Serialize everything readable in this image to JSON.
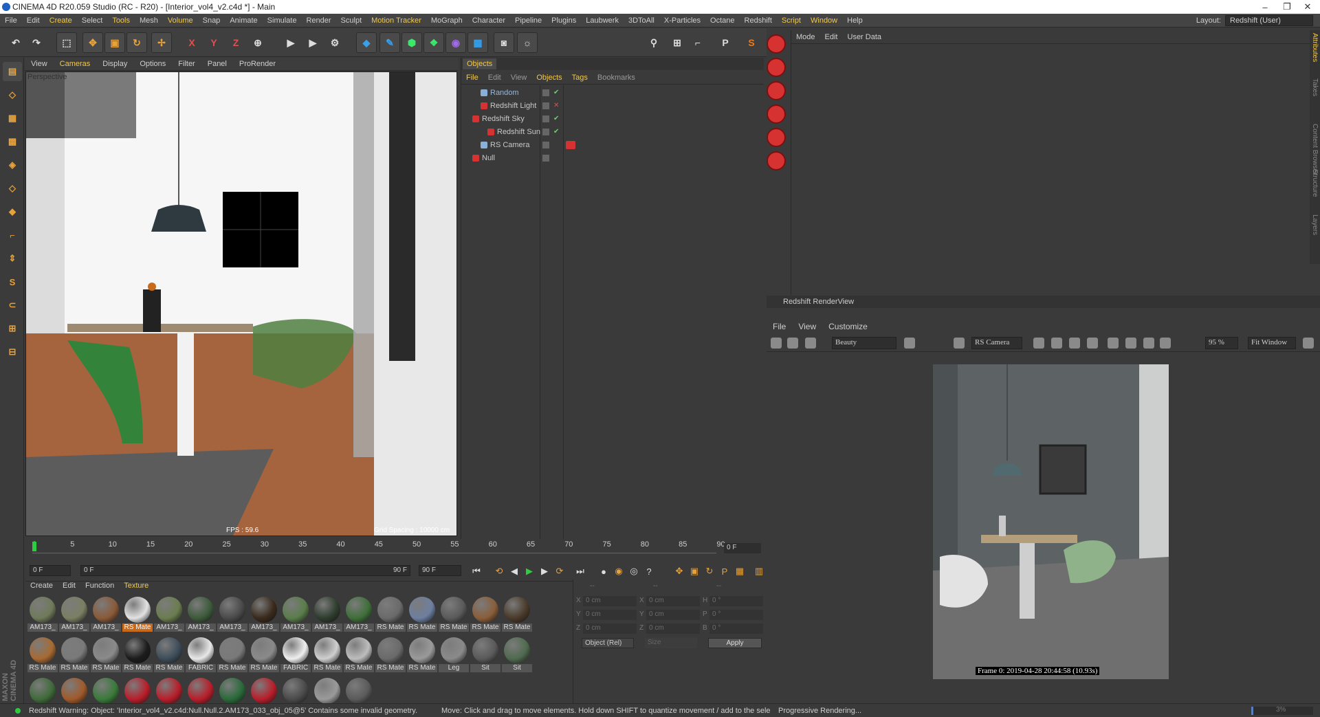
{
  "window": {
    "title": "CINEMA 4D R20.059 Studio (RC - R20) - [Interior_vol4_v2.c4d *] - Main",
    "minimize": "–",
    "restore": "❐",
    "close": "✕"
  },
  "menubar": [
    "File",
    "Edit",
    "Create",
    "Select",
    "Tools",
    "Mesh",
    "Volume",
    "Snap",
    "Animate",
    "Simulate",
    "Render",
    "Sculpt",
    "Motion Tracker",
    "MoGraph",
    "Character",
    "Pipeline",
    "Plugins",
    "Laubwerk",
    "3DToAll",
    "X-Particles",
    "Octane",
    "Redshift",
    "Script",
    "Window",
    "Help"
  ],
  "menubar_highlight": [
    "Create",
    "Tools",
    "Volume",
    "Motion Tracker",
    "Script",
    "Window"
  ],
  "layout": {
    "label": "Layout:",
    "value": "Redshift (User)"
  },
  "toolbar_icons": [
    "undo-icon",
    "redo-icon",
    "live-select-icon",
    "move-icon",
    "scale-icon",
    "rotate-icon",
    "transform-icon",
    "x-axis-icon",
    "y-axis-icon",
    "z-axis-icon",
    "coordinate-system-icon",
    "render-view-icon",
    "render-picture-queue-icon",
    "render-settings-icon",
    "cube-icon",
    "pen-icon",
    "subdivision-icon",
    "cloner-icon",
    "deformer-icon",
    "floor-icon",
    "camera-icon",
    "light-icon",
    "snap-icon",
    "workplane-icon",
    "axis-icon",
    "per-icon",
    "s-logo-icon"
  ],
  "left_tool_icons": [
    "make-editable-icon",
    "model-mode-icon",
    "texture-mode-icon",
    "workplane-mode-icon",
    "points-mode-icon",
    "edges-mode-icon",
    "polygons-mode-icon",
    "axis-mode-icon",
    "tweak-mode-icon",
    "solo-mode-icon",
    "magnet-icon",
    "snap-settings-icon",
    "uv-mode-icon"
  ],
  "viewport": {
    "menu": [
      "View",
      "Cameras",
      "Display",
      "Options",
      "Filter",
      "Panel",
      "ProRender"
    ],
    "menu_highlight": [
      "Cameras"
    ],
    "label": "Perspective",
    "fps": "FPS : 59.6",
    "grid": "Grid Spacing : 10000 cm"
  },
  "objects": {
    "tab": "Objects",
    "menu": [
      "File",
      "Edit",
      "View",
      "Objects",
      "Tags",
      "Bookmarks"
    ],
    "menu_highlight": [
      "File",
      "Objects",
      "Tags"
    ],
    "rows": [
      {
        "name": "Random",
        "color": "#9ab6d6",
        "vis": "✔",
        "vis_color": "#6fcf6f"
      },
      {
        "name": "Redshift Light",
        "color": "#c8c8c8",
        "vis": "✕",
        "vis_color": "#e05050"
      },
      {
        "name": "Redshift Sky",
        "color": "#c8c8c8",
        "vis": "✔",
        "vis_color": "#6fcf6f"
      },
      {
        "name": "Redshift Sun",
        "color": "#c8c8c8",
        "vis": "✔",
        "vis_color": "#6fcf6f"
      },
      {
        "name": "RS Camera",
        "color": "#c8c8c8",
        "vis": "",
        "vis_color": "#6fcf6f"
      },
      {
        "name": "Null",
        "color": "#c8c8c8",
        "vis": "",
        "vis_color": "#6fcf6f"
      }
    ]
  },
  "attributes": {
    "menu": [
      "Mode",
      "Edit",
      "User Data"
    ]
  },
  "sidetabs": [
    "Attributes",
    "Takes",
    "Content Browser",
    "Structure",
    "Layers"
  ],
  "renderview": {
    "title": "Redshift RenderView",
    "menu": [
      "File",
      "View",
      "Customize"
    ],
    "aov": "Beauty",
    "camera": "RS Camera",
    "zoom": "95 %",
    "fit": "Fit Window",
    "stamp": "Frame  0:  2019-04-28  20:44:58  (10.93s)"
  },
  "timeline": {
    "ticks": [
      "0",
      "5",
      "10",
      "15",
      "20",
      "25",
      "30",
      "35",
      "40",
      "45",
      "50",
      "55",
      "60",
      "65",
      "70",
      "75",
      "80",
      "85",
      "90"
    ],
    "current_frame": "0 F"
  },
  "transport": {
    "start": "0 F",
    "min": "0 F",
    "max": "90 F",
    "end": "90 F"
  },
  "materials": {
    "menu": [
      "Create",
      "Edit",
      "Function",
      "Texture"
    ],
    "menu_highlight": [
      "Texture"
    ],
    "items": [
      {
        "label": "AM173_",
        "color": "#6f7a5a"
      },
      {
        "label": "AM173_",
        "color": "#7b7f62"
      },
      {
        "label": "AM173_",
        "color": "#8a5a38"
      },
      {
        "label": "RS Mate",
        "color": "#e2e2e2",
        "selected": true
      },
      {
        "label": "AM173_",
        "color": "#6b7d4f"
      },
      {
        "label": "AM173_",
        "color": "#3c5a3a"
      },
      {
        "label": "AM173_",
        "color": "#4a4a4a"
      },
      {
        "label": "AM173_",
        "color": "#3a2a1c"
      },
      {
        "label": "AM173_",
        "color": "#5a7d4a"
      },
      {
        "label": "AM173_",
        "color": "#2e3d2e"
      },
      {
        "label": "AM173_",
        "color": "#3f6f3a"
      },
      {
        "label": "RS Mate",
        "color": "#6a6a6a"
      },
      {
        "label": "RS Mate",
        "color": "#6d7fa0"
      },
      {
        "label": "RS Mate",
        "color": "#5a5a5a"
      },
      {
        "label": "RS Mate",
        "color": "#8a5e3a"
      },
      {
        "label": "RS Mate",
        "color": "#4a3a2a"
      },
      {
        "label": "RS Mate",
        "color": "#a86a32"
      },
      {
        "label": "RS Mate",
        "color": "#7a7a7a"
      },
      {
        "label": "RS Mate",
        "color": "#8a8a8a"
      },
      {
        "label": "RS Mate",
        "color": "#1c1c1c"
      },
      {
        "label": "RS Mate",
        "color": "#3d4d5a"
      },
      {
        "label": "FABRIC",
        "color": "#e8e8e8"
      },
      {
        "label": "RS Mate",
        "color": "#7a7a7a"
      },
      {
        "label": "RS Mate",
        "color": "#8a8a8a"
      },
      {
        "label": "FABRIC",
        "color": "#efefef"
      },
      {
        "label": "RS Mate",
        "color": "#cfcfcf"
      },
      {
        "label": "RS Mate",
        "color": "#bdbdbd"
      },
      {
        "label": "RS Mate",
        "color": "#6a6a6a"
      },
      {
        "label": "RS Mate",
        "color": "#9a9a9a"
      },
      {
        "label": "Leg",
        "color": "#8a8a8a"
      },
      {
        "label": "Sit",
        "color": "#5a5a5a"
      },
      {
        "label": "Sit",
        "color": "#4f6a4f"
      },
      {
        "label": "",
        "color": "#3f6a3a"
      },
      {
        "label": "",
        "color": "#a05a2a"
      },
      {
        "label": "",
        "color": "#3a7a3a"
      },
      {
        "label": "",
        "color": "#b81e2a"
      },
      {
        "label": "",
        "color": "#b81e2a"
      },
      {
        "label": "",
        "color": "#b81e2a"
      },
      {
        "label": "",
        "color": "#2a6a3a"
      },
      {
        "label": "",
        "color": "#b81e2a"
      },
      {
        "label": "",
        "color": "#4a4a4a"
      },
      {
        "label": "",
        "color": "#9a9a9a"
      },
      {
        "label": "",
        "color": "#5a5a5a"
      }
    ]
  },
  "coords": {
    "headers": [
      "--",
      "--",
      "--"
    ],
    "rows": [
      {
        "a": "X",
        "av": "0 cm",
        "b": "X",
        "bv": "0 cm",
        "c": "H",
        "cv": "0 °"
      },
      {
        "a": "Y",
        "av": "0 cm",
        "b": "Y",
        "bv": "0 cm",
        "c": "P",
        "cv": "0 °"
      },
      {
        "a": "Z",
        "av": "0 cm",
        "b": "Z",
        "bv": "0 cm",
        "c": "B",
        "cv": "0 °"
      }
    ],
    "mode": "Object (Rel)",
    "size": "Size",
    "apply": "Apply"
  },
  "status": {
    "warning": "Redshift Warning: Object: 'Interior_vol4_v2.c4d:Null.Null.2.AM173_033_obj_05@5' Contains some invalid geometry.",
    "hint": "Move: Click and drag to move elements. Hold down SHIFT to quantize movement / add to the sele",
    "render": "Progressive Rendering...",
    "progress": 0.03,
    "progress_value": "3%"
  },
  "logo": "MAXON CINEMA 4D"
}
